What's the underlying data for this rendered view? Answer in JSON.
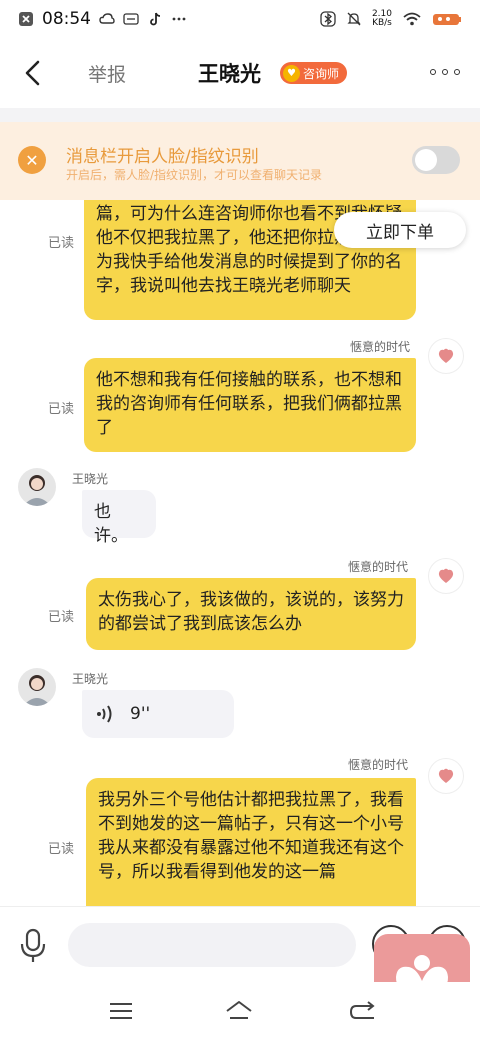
{
  "status_bar": {
    "time": "08:54",
    "net_speed_value": "2.10",
    "net_speed_unit": "KB/s"
  },
  "nav": {
    "report_label": "举报",
    "peer_name": "王晓光",
    "badge_label": "咨询师"
  },
  "notice": {
    "title": "消息栏开启人脸/指纹识别",
    "subtitle": "开启后，需人脸/指纹识别，才可以查看聊天记录",
    "toggle_on": false
  },
  "order_button_label": "立即下单",
  "messages": [
    {
      "direction": "out",
      "sender": "",
      "status": "已读",
      "text": "篇，可为什么连咨询师你也看不到我怀疑他不仅把我拉黑了，他还把你拉黑了，因为我快手给他发消息的时候提到了你的名字，我说叫他去找王晓光老师聊天"
    },
    {
      "direction": "out",
      "sender": "惬意的时代",
      "status": "已读",
      "text": "他不想和我有任何接触的联系，也不想和我的咨询师有任何联系，把我们俩都拉黑了"
    },
    {
      "direction": "in",
      "sender": "王晓光",
      "text": "也许。"
    },
    {
      "direction": "out",
      "sender": "惬意的时代",
      "status": "已读",
      "text": "太伤我心了，我该做的，该说的，该努力的都尝试了我到底该怎么办"
    },
    {
      "direction": "in",
      "sender": "王晓光",
      "voice_duration": "9''"
    },
    {
      "direction": "out",
      "sender": "惬意的时代",
      "status": "已读",
      "text": "我另外三个号他估计都把我拉黑了，我看不到她发的这一篇帖子，只有这一个小号我从来都没有暴露过他不知道我还有这个号，所以我看得到他发的这一篇"
    }
  ],
  "input": {
    "placeholder": ""
  },
  "colors": {
    "outgoing_bubble": "#f7d64b",
    "incoming_bubble": "#f3f3f7",
    "badge": "#f26a3c",
    "notice_bg": "#fdefe0",
    "notice_text": "#e89a3c"
  }
}
